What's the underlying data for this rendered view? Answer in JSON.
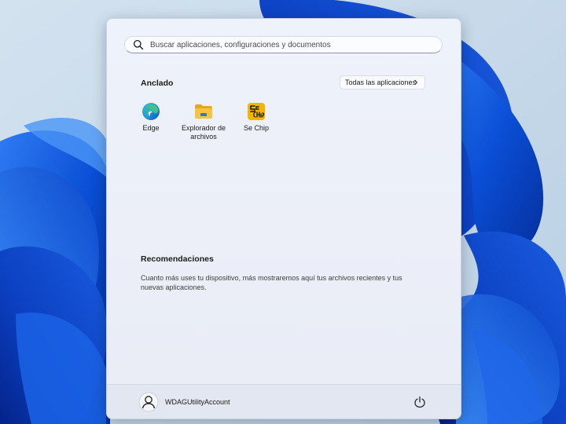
{
  "search": {
    "placeholder": "Buscar aplicaciones, configuraciones y documentos",
    "icon": "search-icon"
  },
  "pinned": {
    "title": "Anclado",
    "all_apps_label": "Todas las aplicaciones",
    "apps": [
      {
        "label": "Edge",
        "icon": "edge-icon"
      },
      {
        "label": "Explorador de archivos",
        "icon": "folder-icon"
      },
      {
        "label": "Se Chip",
        "icon": "sechip-icon"
      }
    ]
  },
  "recommended": {
    "title": "Recomendaciones",
    "text": "Cuanto más uses tu dispositivo, más mostraremos aquí tus archivos recientes y tus nuevas aplicaciones."
  },
  "footer": {
    "user_name": "WDAGUtilityAccount",
    "avatar_icon": "user-avatar-icon",
    "power_icon": "power-icon"
  },
  "colors": {
    "wallpaper_blue": "#0a4fd6",
    "wallpaper_bg": "#c7d9ea",
    "menu_bg": "#eceff8",
    "edge_blue": "#0c7bd8",
    "edge_green": "#4fc14a",
    "folder_yellow": "#f6c440",
    "sechip_yellow": "#f4b400"
  }
}
